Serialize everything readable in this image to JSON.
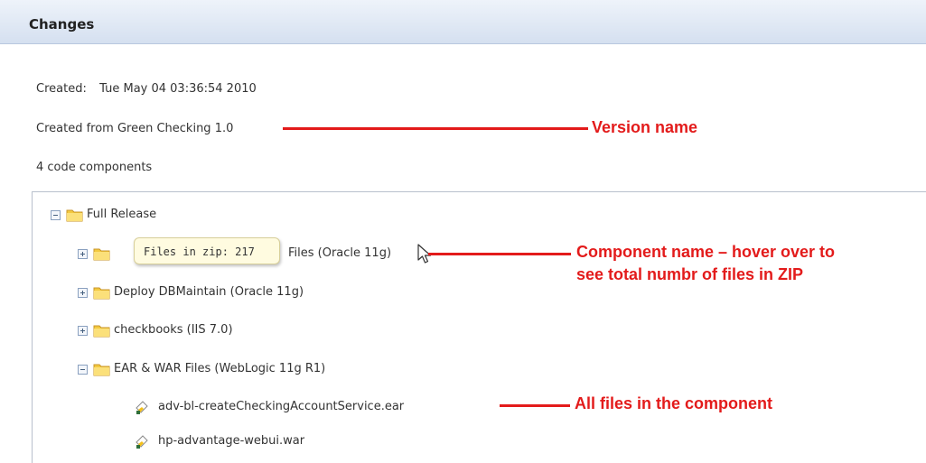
{
  "header": {
    "title": "Changes"
  },
  "details": {
    "created_label": "Created:",
    "created_value": "Tue May 04 03:36:54 2010",
    "created_from": "Created from Green Checking 1.0",
    "components_count": "4 code components"
  },
  "tree": {
    "root_label": "Full Release",
    "components": [
      {
        "label": "Files (Oracle 11g)",
        "expanded": false
      },
      {
        "label": "Deploy DBMaintain (Oracle 11g)",
        "expanded": false
      },
      {
        "label": "checkbooks (IIS 7.0)",
        "expanded": false
      },
      {
        "label": "EAR & WAR Files (WebLogic 11g R1)",
        "expanded": true
      }
    ],
    "files": [
      "adv-bl-createCheckingAccountService.ear",
      "hp-advantage-webui.war"
    ]
  },
  "tooltip": {
    "text": "Files in zip: 217"
  },
  "annotations": {
    "version_name": "Version name",
    "component_name_line1": "Component name – hover over to",
    "component_name_line2": "see total numbr of files in ZIP",
    "all_files": "All files in the component"
  },
  "colors": {
    "annotation": "#e31b1b",
    "folder": "#f3c93f",
    "header": "#d5e0f0"
  },
  "icons": [
    "collapse-toggle-icon",
    "expand-toggle-icon",
    "folder-icon",
    "file-icon",
    "mouse-cursor-icon"
  ]
}
